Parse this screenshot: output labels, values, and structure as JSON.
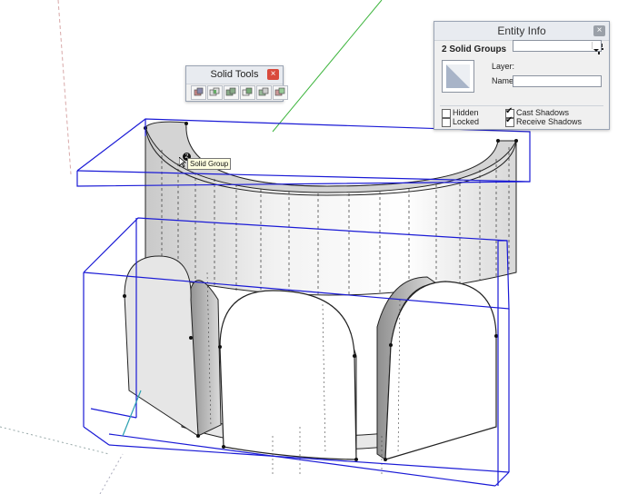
{
  "solid_tools": {
    "title": "Solid Tools",
    "close_label": "×",
    "tools": [
      "outer-shell-icon",
      "intersect-icon",
      "union-icon",
      "subtract-icon",
      "trim-icon",
      "split-icon"
    ]
  },
  "entity_info": {
    "title": "Entity Info",
    "close_label": "×",
    "selection_label": "2 Solid Groups",
    "layer_label": "Layer:",
    "layer_value": "",
    "name_label": "Name:",
    "name_value": "",
    "hidden_label": "Hidden",
    "hidden_checked": false,
    "locked_label": "Locked",
    "locked_checked": false,
    "cast_shadows_label": "Cast Shadows",
    "cast_shadows_checked": true,
    "receive_shadows_label": "Receive Shadows",
    "receive_shadows_checked": true
  },
  "tooltip": {
    "badge": "2",
    "text": "Solid Group"
  },
  "colors": {
    "selection_blue": "#1a1ad6",
    "axis_green": "#3cb43c",
    "axis_red": "#e03232",
    "close_red": "#d94a3d"
  }
}
